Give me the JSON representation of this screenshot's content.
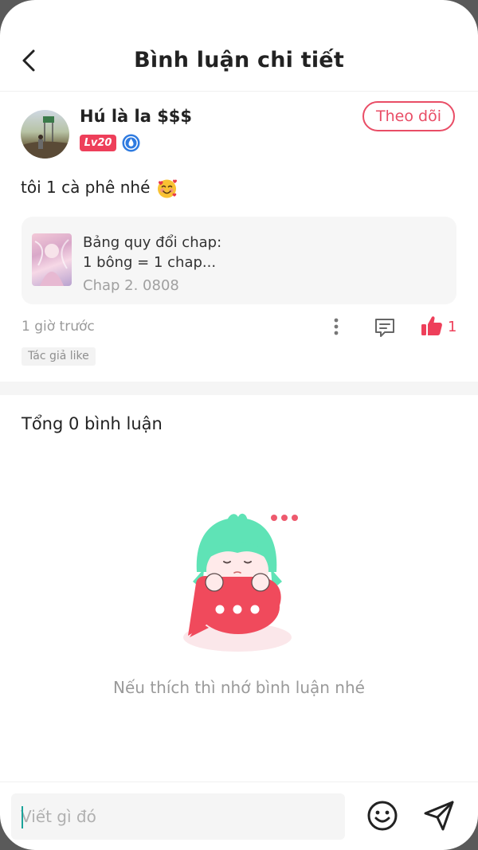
{
  "header": {
    "title": "Bình luận chi tiết",
    "back_icon": "chevron-left-icon"
  },
  "comment": {
    "username": "Hú là la $$$",
    "level": "Lv20",
    "follow_label": "Theo dõi",
    "text": "tôi 1 cà phê nhé",
    "emoji": "smiling-face-with-hearts",
    "chapter": {
      "line1": "Bảng quy đổi chap:",
      "line2": "1 bông = 1 chap...",
      "name": "Chap 2. 0808"
    },
    "time_ago": "1 giờ trước",
    "like_count": "1",
    "author_like_tag": "Tác giả like"
  },
  "comments_section": {
    "total_label": "Tổng 0 bình luận",
    "empty_text": "Nếu thích thì nhớ bình luận nhé"
  },
  "input": {
    "placeholder": "Viết gì đó"
  },
  "colors": {
    "accent": "#ee3f5a",
    "follow": "#e94d66",
    "mascot_hair": "#5fe3b6",
    "caret": "#1aa39a"
  }
}
